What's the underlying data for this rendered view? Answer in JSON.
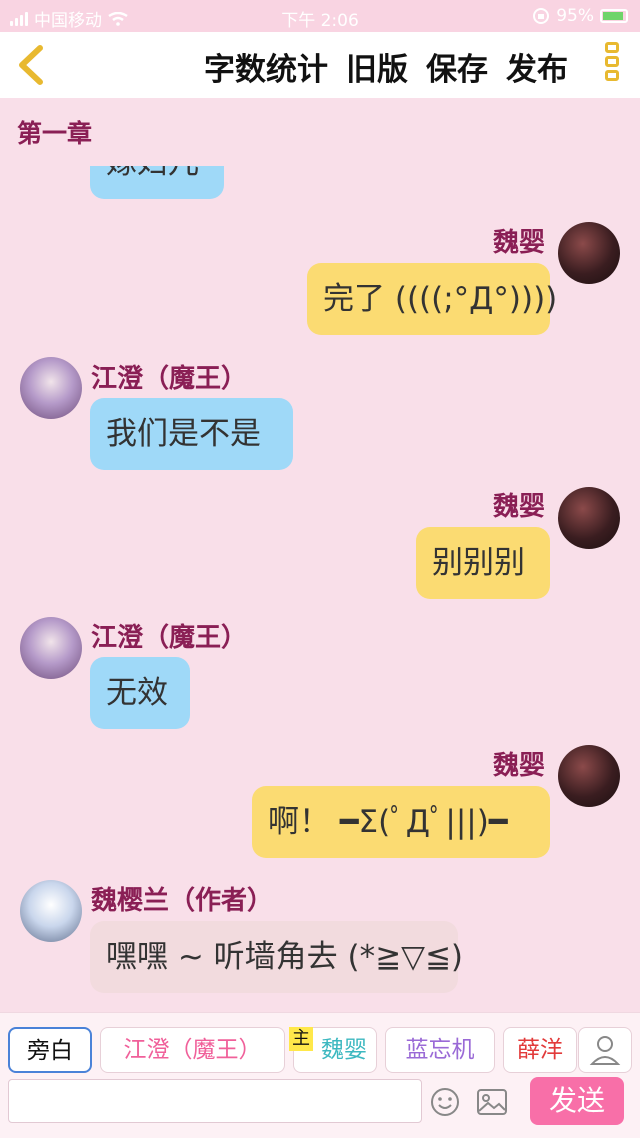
{
  "status_bar": {
    "carrier": "中国移动",
    "time": "下午 2:06",
    "battery": "95%",
    "icons": [
      "signal-icon",
      "wifi-icon",
      "lock-rotation-icon",
      "battery-icon"
    ]
  },
  "toolbar": {
    "back_icon": "chevron-left-icon",
    "word_count": "字数统计",
    "old_version": "旧版",
    "save": "保存",
    "publish": "发布",
    "menu_icon": "menu-icon"
  },
  "chapter_title": "第一章",
  "messages": [
    {
      "side": "left",
      "text": "嫁妇儿"
    },
    {
      "side": "right",
      "name": "魏婴",
      "text": "完了 ((((;°Д°))))"
    },
    {
      "side": "left",
      "name": "江澄（魔王）",
      "text": "我们是不是"
    },
    {
      "side": "right",
      "name": "魏婴",
      "text": "别别别"
    },
    {
      "side": "left",
      "name": "江澄（魔王）",
      "text": "无效"
    },
    {
      "side": "right",
      "name": "魏婴",
      "text": "啊！ ━Σ(ﾟДﾟ|||)━"
    },
    {
      "side": "left",
      "name": "魏樱兰（作者）",
      "text": "嘿嘿 ~ 听墙角去 (*≧▽≦)"
    }
  ],
  "characters": [
    {
      "label": "旁白",
      "color": "#111111",
      "selected": true
    },
    {
      "label": "江澄（魔王）",
      "color": "#f0609a",
      "selected": false
    },
    {
      "label": "魏婴",
      "color": "#3cb8c0",
      "selected": false,
      "tag": "主"
    },
    {
      "label": "蓝忘机",
      "color": "#9a6ad6",
      "selected": false
    },
    {
      "label": "薛洋",
      "color": "#e23a3a",
      "selected": false
    }
  ],
  "input": {
    "placeholder": "",
    "value": ""
  },
  "send_label": "发送",
  "colors": {
    "accent": "#f86fa8",
    "name": "#8a1f55",
    "bubble_left": "#9fd9f8",
    "bubble_right": "#fbdb72",
    "bubble_author": "#f2dbde"
  }
}
